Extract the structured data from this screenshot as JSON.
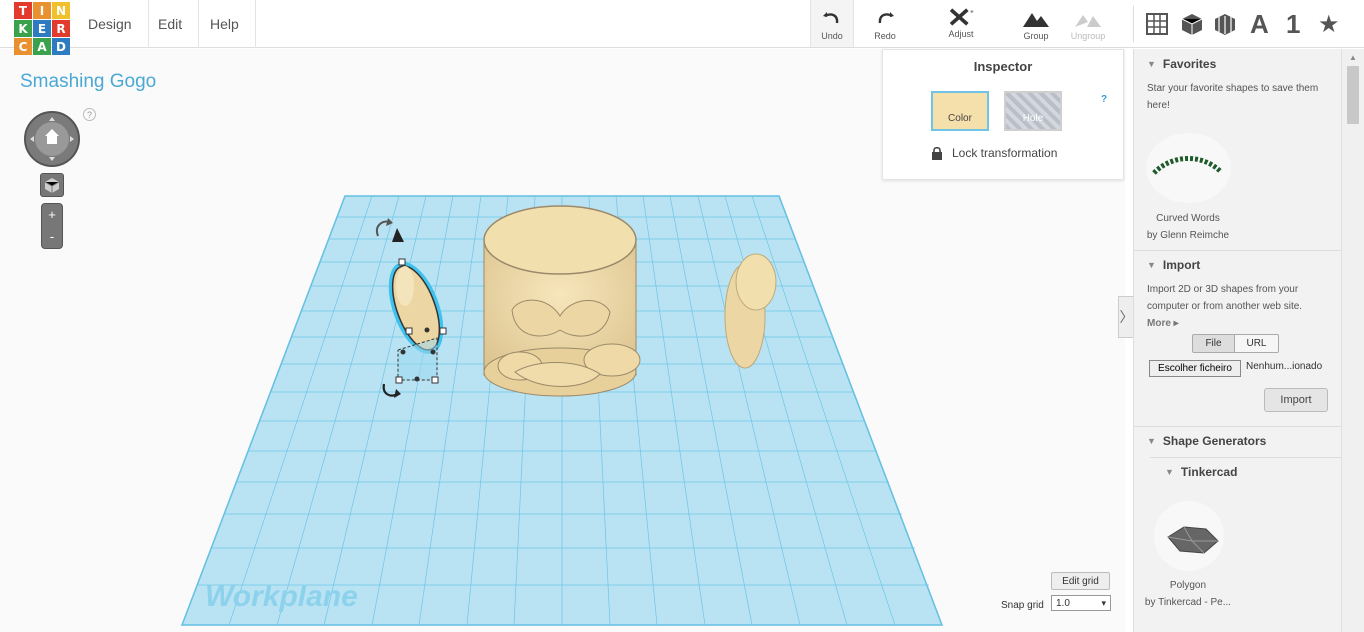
{
  "logo": {
    "letters": [
      "T",
      "I",
      "N",
      "K",
      "E",
      "R",
      "C",
      "A",
      "D"
    ],
    "colors": [
      "#e23b2e",
      "#e8912e",
      "#f0c12c",
      "#3aa14c",
      "#2d7cc1",
      "#e23b2e",
      "#e8912e",
      "#3aa14c",
      "#2d7cc1"
    ]
  },
  "menu": {
    "design": "Design",
    "edit": "Edit",
    "help": "Help"
  },
  "toolbar": {
    "undo": "Undo",
    "redo": "Redo",
    "adjust": "Adjust",
    "group": "Group",
    "ungroup": "Ungroup"
  },
  "view_icons": [
    "grid-view-icon",
    "box-view-icon",
    "wireframe-view-icon",
    "text-icon",
    "number-icon",
    "favorites-star-icon"
  ],
  "view_labels": {
    "letter": "A",
    "number": "1",
    "star": "★"
  },
  "project": {
    "title": "Smashing Gogo"
  },
  "nav": {
    "help": "?",
    "zoom_in": "+",
    "zoom_out": "-"
  },
  "workplane": {
    "label": "Workplane"
  },
  "grid": {
    "edit_label": "Edit grid",
    "snap_label": "Snap grid",
    "snap_value": "1.0"
  },
  "inspector": {
    "title": "Inspector",
    "help": "?",
    "color_label": "Color",
    "hole_label": "Hole",
    "lock_label": "Lock transformation",
    "color_value": "#f5dfaa"
  },
  "sidebar": {
    "favorites": {
      "title": "Favorites",
      "text": "Star your favorite shapes to save them here!",
      "shape_name": "Curved Words",
      "shape_author": "by Glenn Reimche"
    },
    "import": {
      "title": "Import",
      "text": "Import 2D or 3D shapes from your computer or from another web site.",
      "more": "More ▸",
      "tab_file": "File",
      "tab_url": "URL",
      "choose_file": "Escolher ficheiro",
      "file_status": "Nenhum...ionado",
      "button": "Import"
    },
    "generators": {
      "title": "Shape Generators",
      "sub_title": "Tinkercad",
      "shape_name": "Polygon",
      "shape_author": "by Tinkercad - Pe..."
    }
  },
  "colors": {
    "accent": "#4aa8d4",
    "grid": "#8fd3ec",
    "object": "#f1dfae"
  }
}
